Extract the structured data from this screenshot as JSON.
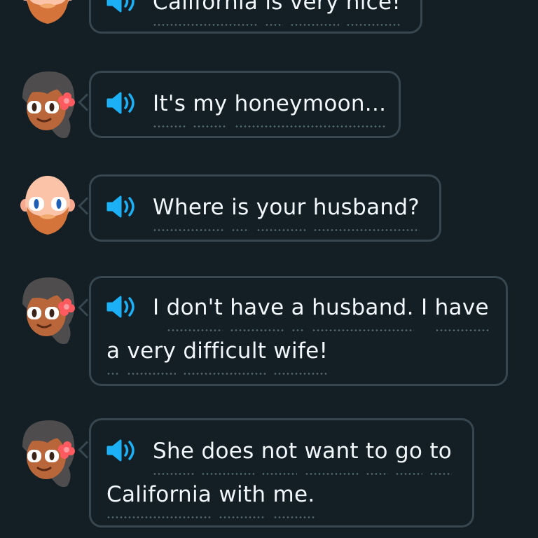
{
  "colors": {
    "background": "#131f24",
    "bubble_border": "#37464f",
    "text": "#f1f7fb",
    "speaker": "#1cb0f6",
    "hint_dots": "#52656d"
  },
  "messages": [
    {
      "speaker_character": "bald-man",
      "lines": [
        [
          {
            "text": "California",
            "hint": true
          },
          {
            "text": "is",
            "hint": true
          },
          {
            "text": "very",
            "hint": true
          },
          {
            "text": "nice!",
            "hint": true
          }
        ]
      ]
    },
    {
      "speaker_character": "woman-with-flower",
      "lines": [
        [
          {
            "text": "It's",
            "hint": true
          },
          {
            "text": "my",
            "hint": true
          },
          {
            "text": "honeymoon...",
            "hint": true
          }
        ]
      ]
    },
    {
      "speaker_character": "bald-man",
      "lines": [
        [
          {
            "text": "Where",
            "hint": true
          },
          {
            "text": "is",
            "hint": true
          },
          {
            "text": "your",
            "hint": true
          },
          {
            "text": "husband?",
            "hint": true
          }
        ]
      ]
    },
    {
      "speaker_character": "woman-with-flower",
      "lines": [
        [
          {
            "text": "I",
            "hint": false
          },
          {
            "text": "don't",
            "hint": true
          },
          {
            "text": "have",
            "hint": true
          },
          {
            "text": "a",
            "hint": true
          },
          {
            "text": "husband.",
            "hint": true
          },
          {
            "text": "I",
            "hint": false
          },
          {
            "text": "have",
            "hint": true
          }
        ],
        [
          {
            "text": "a",
            "hint": true
          },
          {
            "text": "very",
            "hint": true
          },
          {
            "text": "difficult",
            "hint": true
          },
          {
            "text": "wife!",
            "hint": true
          }
        ]
      ]
    },
    {
      "speaker_character": "woman-with-flower",
      "lines": [
        [
          {
            "text": "She",
            "hint": true
          },
          {
            "text": "does",
            "hint": true
          },
          {
            "text": "not",
            "hint": true
          },
          {
            "text": "want",
            "hint": true
          },
          {
            "text": "to",
            "hint": true
          },
          {
            "text": "go",
            "hint": true
          },
          {
            "text": "to",
            "hint": true
          }
        ],
        [
          {
            "text": "California",
            "hint": true
          },
          {
            "text": "with",
            "hint": true
          },
          {
            "text": "me.",
            "hint": true
          }
        ]
      ]
    }
  ]
}
